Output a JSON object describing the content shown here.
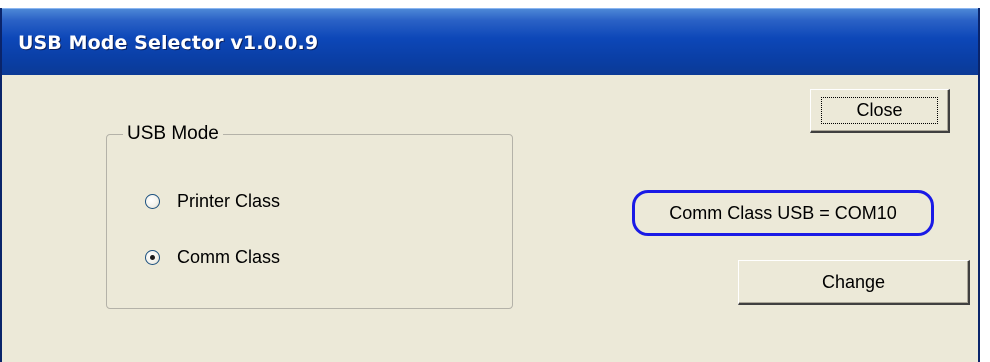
{
  "window": {
    "title": "USB Mode Selector v1.0.0.9"
  },
  "group": {
    "label": "USB Mode",
    "options": [
      {
        "label": "Printer Class",
        "selected": false
      },
      {
        "label": "Comm Class",
        "selected": true
      }
    ]
  },
  "buttons": {
    "close_label": "Close",
    "change_label": "Change"
  },
  "status": {
    "text": "Comm Class USB = COM10"
  },
  "colors": {
    "titlebar": "#0a3fa6",
    "window_bg": "#ece9d8",
    "highlight_border": "#1a1ae6"
  }
}
